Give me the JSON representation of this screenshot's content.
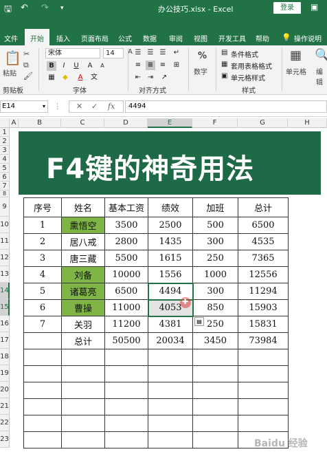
{
  "titlebar": {
    "title": "办公技巧.xlsx - Excel",
    "login": "登录"
  },
  "tabs": [
    "文件",
    "开始",
    "插入",
    "页面布局",
    "公式",
    "数据",
    "审阅",
    "视图",
    "开发工具",
    "帮助",
    "操作说明搜"
  ],
  "ribbon": {
    "paste": "粘贴",
    "clipboard": "剪贴板",
    "font_name": "宋体",
    "font_size": "14",
    "font_group": "字体",
    "align_group": "对齐方式",
    "number": "数字",
    "number_symbol": "%",
    "cond_format": "条件格式",
    "table_format": "套用表格格式",
    "cell_style": "单元格样式",
    "style_group": "样式",
    "cells": "单元格",
    "edit": "编辑"
  },
  "formula_bar": {
    "namebox": "E14",
    "fx": "fx",
    "value": "4494"
  },
  "columns": [
    "A",
    "B",
    "C",
    "D",
    "E",
    "F",
    "G",
    "H"
  ],
  "rows": [
    "1",
    "2",
    "3",
    "4",
    "5",
    "6",
    "7",
    "8",
    "9",
    "10",
    "11",
    "12",
    "13",
    "14",
    "15",
    "16",
    "17",
    "18",
    "19",
    "20",
    "21",
    "22",
    "23"
  ],
  "banner": "F4键的神奇用法",
  "table": {
    "headers": [
      "序号",
      "姓名",
      "基本工资",
      "绩效",
      "加班",
      "总计"
    ],
    "rows": [
      [
        "1",
        "熏悟空",
        "3500",
        "2500",
        "500",
        "6500"
      ],
      [
        "2",
        "居八戒",
        "2800",
        "1435",
        "300",
        "4535"
      ],
      [
        "3",
        "唐三藏",
        "5500",
        "1615",
        "250",
        "7365"
      ],
      [
        "4",
        "刘备",
        "10000",
        "1556",
        "1000",
        "12556"
      ],
      [
        "5",
        "诸葛亮",
        "6500",
        "4494",
        "300",
        "11294"
      ],
      [
        "6",
        "曹操",
        "11000",
        "4053",
        "850",
        "15903"
      ],
      [
        "7",
        "关羽",
        "11200",
        "4381",
        "250",
        "15831"
      ],
      [
        "",
        "总计",
        "50500",
        "20034",
        "3450",
        "73984"
      ]
    ]
  },
  "watermark": "Baidu 经验",
  "colors": {
    "excel_green": "#217346",
    "banner": "#1e6a46",
    "highlight": "#7fb446"
  }
}
